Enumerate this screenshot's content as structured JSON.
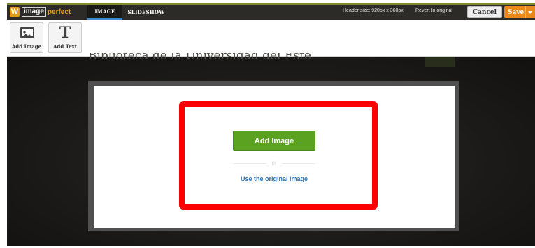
{
  "logo": {
    "mark": "W",
    "boxed_text": "image",
    "suffix": "perfect"
  },
  "tabs": [
    {
      "label": "IMAGE",
      "active": true
    },
    {
      "label": "SLIDESHOW",
      "active": false
    }
  ],
  "header_size": "Header size: 920px x 360px",
  "revert_label": "Revert to original",
  "cancel_label": "Cancel",
  "save_label": "Save",
  "toolbar": {
    "add_image_label": "Add Image",
    "add_text_label": "Add Text",
    "text_tool_glyph": "T",
    "add_image_icon": "image-icon",
    "add_text_icon": "text-icon"
  },
  "background_title": "Biblioteca de la Universidad del Este",
  "dialog": {
    "add_image_button": "Add Image",
    "or_text": "or",
    "use_original_link": "Use the original image"
  },
  "colors": {
    "accent_green": "#5aa220",
    "save_orange": "#e8891a",
    "highlight_red": "#ff0000",
    "link_blue": "#2a76b9"
  }
}
